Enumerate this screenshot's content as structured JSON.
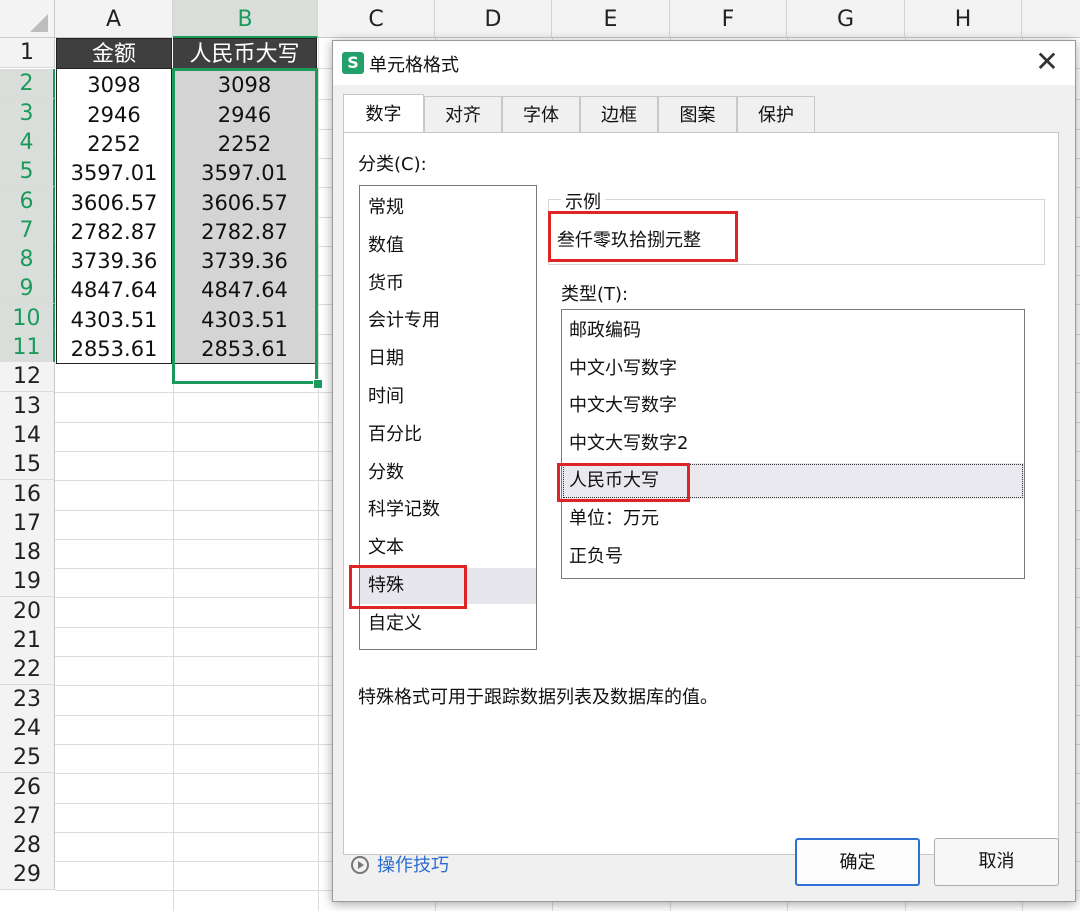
{
  "sheet": {
    "columns": [
      "A",
      "B",
      "C",
      "D",
      "E",
      "F",
      "G",
      "H"
    ],
    "rows": [
      "1",
      "2",
      "3",
      "4",
      "5",
      "6",
      "7",
      "8",
      "9",
      "10",
      "11",
      "12",
      "13",
      "14",
      "15",
      "16",
      "17",
      "18",
      "19",
      "20",
      "21",
      "22",
      "23",
      "24",
      "25",
      "26",
      "27",
      "28",
      "29"
    ],
    "header_a": "金额",
    "header_b": "人民币大写",
    "values_a": [
      "3098",
      "2946",
      "2252",
      "3597.01",
      "3606.57",
      "2782.87",
      "3739.36",
      "4847.64",
      "4303.51",
      "2853.61"
    ],
    "values_b": [
      "3098",
      "2946",
      "2252",
      "3597.01",
      "3606.57",
      "2782.87",
      "3739.36",
      "4847.64",
      "4303.51",
      "2853.61"
    ]
  },
  "dialog": {
    "icon_letter": "S",
    "title": "单元格格式",
    "close": "✕",
    "tabs": [
      "数字",
      "对齐",
      "字体",
      "边框",
      "图案",
      "保护"
    ],
    "category_label": "分类(C):",
    "categories": [
      "常规",
      "数值",
      "货币",
      "会计专用",
      "日期",
      "时间",
      "百分比",
      "分数",
      "科学记数",
      "文本",
      "特殊",
      "自定义"
    ],
    "example_label": "示例",
    "example_value": "叁仟零玖拾捌元整",
    "type_label": "类型(T):",
    "types": [
      "邮政编码",
      "中文小写数字",
      "中文大写数字",
      "中文大写数字2",
      "人民币大写",
      "单位：万元",
      "正负号"
    ],
    "description": "特殊格式可用于跟踪数据列表及数据库的值。",
    "tips": "操作技巧",
    "ok": "确定",
    "cancel": "取消"
  }
}
